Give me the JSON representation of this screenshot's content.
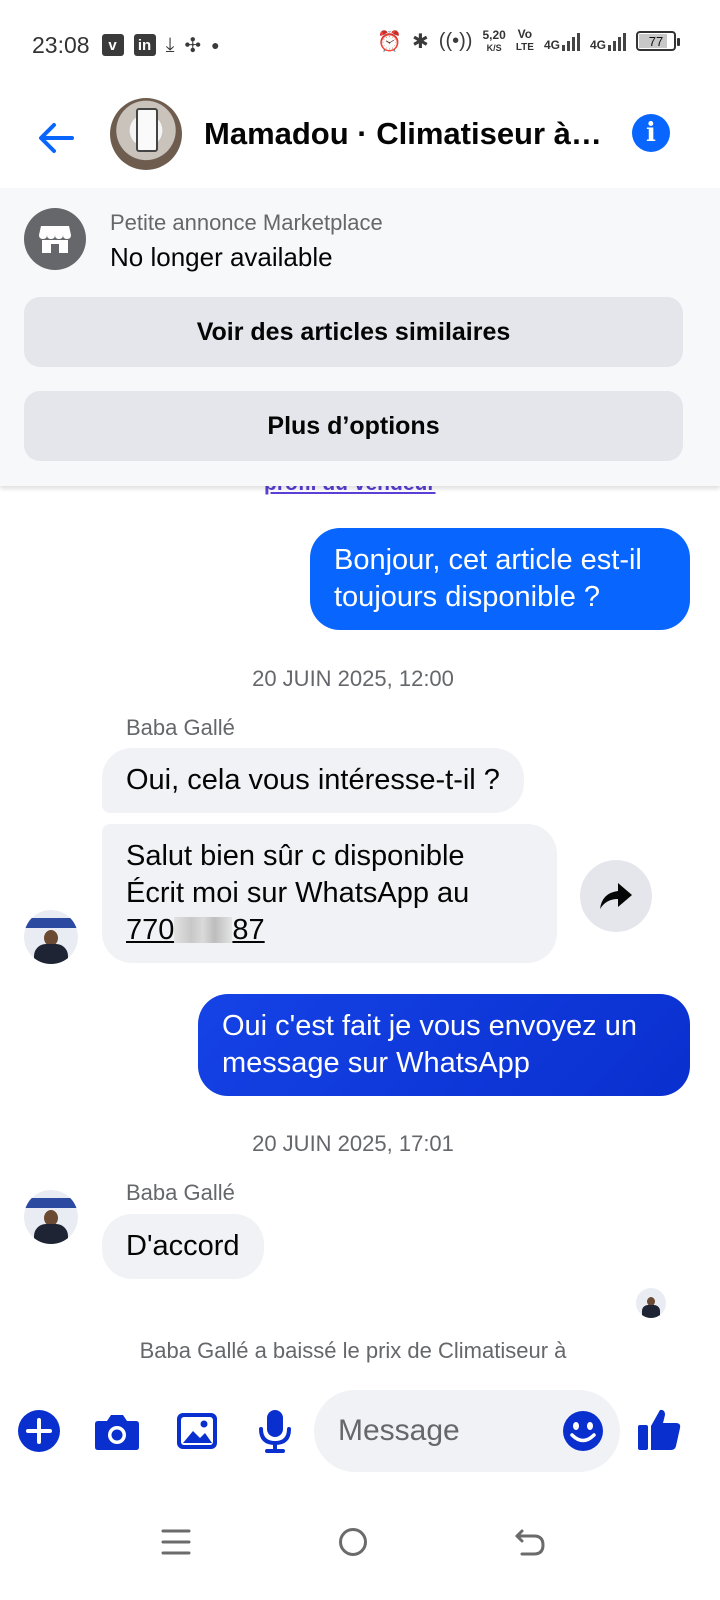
{
  "status_bar": {
    "time": "23:08",
    "speed_value": "5,20",
    "speed_unit": "K/S",
    "volte_top": "Vo",
    "volte_bottom": "LTE",
    "net1": "4G",
    "net2": "4G",
    "battery": "77",
    "battery_level": 0.77,
    "left_icons": [
      "vimeo-icon",
      "linkedin-icon",
      "download-icon",
      "fan-icon",
      "dot-icon"
    ],
    "right_icons": [
      "alarm-icon",
      "bluetooth-icon",
      "hotspot-icon",
      "speed-indicator",
      "volte-icon",
      "signal-icon",
      "signal-icon",
      "battery-icon"
    ]
  },
  "header": {
    "title": "Mamadou · Climatiseur à e...",
    "back_icon": "arrow-left-icon",
    "info_icon": "info-icon",
    "info_glyph": "i"
  },
  "marketplace": {
    "subtitle": "Petite annonce Marketplace",
    "status": "No longer available",
    "buttons": [
      "Voir des articles similaires",
      "Plus d’options"
    ]
  },
  "chat": {
    "profile_link": "profil du vendeur",
    "messages": [
      {
        "type": "outgoing",
        "text": "Bonjour, cet article est-il toujours disponible ?"
      },
      {
        "type": "timestamp",
        "text": "20 JUIN 2025, 12:00"
      },
      {
        "type": "sender",
        "text": "Baba Gallé"
      },
      {
        "type": "incoming",
        "text": "Oui, cela vous intéresse-t-il ?"
      },
      {
        "type": "incoming",
        "line1": "Salut bien sûr c disponible",
        "line2": "Écrit moi sur WhatsApp au",
        "phone_start": "770",
        "phone_end": "87"
      },
      {
        "type": "outgoing",
        "text": "Oui c'est fait je vous envoyez un message sur WhatsApp"
      },
      {
        "type": "timestamp",
        "text": "20 JUIN 2025, 17:01"
      },
      {
        "type": "sender",
        "text": "Baba Gallé"
      },
      {
        "type": "incoming",
        "text": "D'accord"
      }
    ],
    "system_message": "Baba Gallé a baissé le prix de Climatiseur à"
  },
  "composer": {
    "placeholder": "Message",
    "icons": [
      "plus-icon",
      "camera-icon",
      "image-icon",
      "microphone-icon",
      "emoji-icon",
      "thumbs-up-icon"
    ]
  },
  "nav": {
    "buttons": [
      "menu-icon",
      "home-icon",
      "back-icon"
    ]
  },
  "colors": {
    "accent": "#0866ff",
    "outgoing_dark": "#0a2fcf",
    "incoming_bg": "#f0f2f5",
    "secondary_text": "#65676b"
  }
}
